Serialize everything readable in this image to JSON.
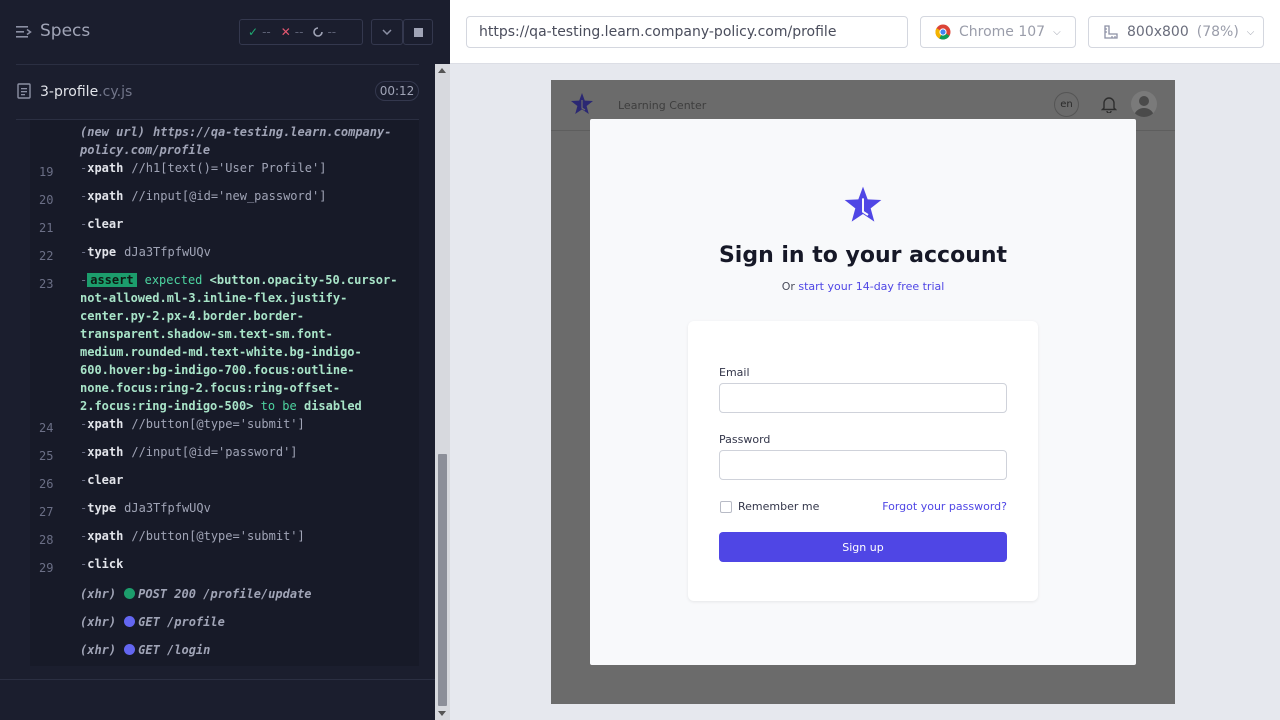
{
  "runner": {
    "specs_label": "Specs",
    "stats": {
      "passed": "--",
      "failed": "--",
      "pending": "--"
    },
    "spec": {
      "name": "3-profile",
      "ext": ".cy.js",
      "duration": "00:12"
    },
    "commands": [
      {
        "num": "",
        "kind": "url",
        "name": "(new url)",
        "msg1": "https://qa-testing.learn.company-",
        "msg2": "policy.com/profile"
      },
      {
        "num": "19",
        "name": "xpath",
        "msg": "//h1[text()='User Profile']"
      },
      {
        "num": "20",
        "name": "xpath",
        "msg": "//input[@id='new_password']"
      },
      {
        "num": "21",
        "name": "clear",
        "msg": ""
      },
      {
        "num": "22",
        "name": "type",
        "msg": "dJa3TfpfwUQv"
      },
      {
        "num": "23",
        "name": "assert",
        "expected": "expected",
        "subject_lines": [
          "<button.opacity-50.cursor-",
          "not-allowed.ml-3.inline-flex.justify-",
          "center.py-2.px-4.border.border-",
          "transparent.shadow-sm.text-sm.font-",
          "medium.rounded-md.text-white.bg-indigo-",
          "600.hover:bg-indigo-700.focus:outline-",
          "none.focus:ring-2.focus:ring-offset-",
          "2.focus:ring-indigo-500>"
        ],
        "to_be": "to be",
        "state": "disabled"
      },
      {
        "num": "24",
        "name": "xpath",
        "msg": "//button[@type='submit']"
      },
      {
        "num": "25",
        "name": "xpath",
        "msg": "//input[@id='password']"
      },
      {
        "num": "26",
        "name": "clear",
        "msg": ""
      },
      {
        "num": "27",
        "name": "type",
        "msg": "dJa3TfpfwUQv"
      },
      {
        "num": "28",
        "name": "xpath",
        "msg": "//button[@type='submit']"
      },
      {
        "num": "29",
        "name": "click",
        "msg": ""
      }
    ],
    "xhr": [
      {
        "label": "(xhr)",
        "text": "POST 200 /profile/update",
        "color": "#1c9d6c"
      },
      {
        "label": "(xhr)",
        "text": "GET /profile",
        "color": "#6366f1"
      },
      {
        "label": "(xhr)",
        "text": "GET /login",
        "color": "#6366f1"
      }
    ]
  },
  "aut": {
    "url": "https://qa-testing.learn.company-policy.com/profile",
    "browser": "Chrome 107",
    "viewport_size": "800x800",
    "viewport_scale": "(78%)"
  },
  "app": {
    "nav_title": "Learning Center",
    "lang": "en",
    "modal_title": "Sign in to your account",
    "subtitle_prefix": "Or",
    "subtitle_link": "start your 14-day free trial",
    "email_label": "Email",
    "password_label": "Password",
    "remember_label": "Remember me",
    "forgot_label": "Forgot your password?",
    "submit_label": "Sign up",
    "brand_color": "#4f46e5"
  }
}
